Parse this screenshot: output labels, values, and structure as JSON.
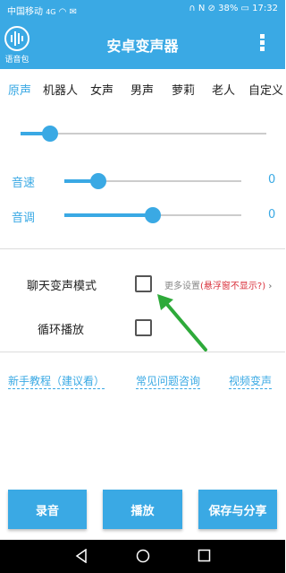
{
  "status": {
    "carrier": "中国移动",
    "network": "4G",
    "battery": "38%",
    "time": "17:32"
  },
  "app": {
    "title": "安卓变声器",
    "logo_label": "语音包",
    "accent_color": "#3aa9e4"
  },
  "tabs": [
    {
      "label": "原声",
      "active": true
    },
    {
      "label": "机器人",
      "active": false
    },
    {
      "label": "女声",
      "active": false
    },
    {
      "label": "男声",
      "active": false
    },
    {
      "label": "萝莉",
      "active": false
    },
    {
      "label": "老人",
      "active": false
    },
    {
      "label": "自定义",
      "active": false
    }
  ],
  "main_slider": {
    "value_fraction": 0.12
  },
  "speed": {
    "label": "音速",
    "value": "0",
    "value_fraction": 0.19
  },
  "pitch": {
    "label": "音调",
    "value": "0",
    "value_fraction": 0.5
  },
  "options": {
    "chat_mode_label": "聊天变声模式",
    "chat_mode_checked": false,
    "more_settings": "更多设置",
    "more_settings_note": "(悬浮窗不显示?)",
    "loop_label": "循环播放",
    "loop_checked": false
  },
  "links": {
    "tutorial": "新手教程（建议看）",
    "faq": "常见问题咨询",
    "video": "视频变声"
  },
  "buttons": {
    "record": "录音",
    "play": "播放",
    "save_share": "保存与分享"
  },
  "annotation_arrow_color": "#2eaa3a"
}
